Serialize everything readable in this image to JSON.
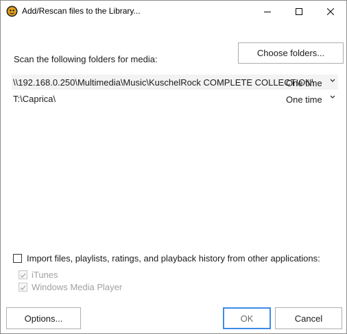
{
  "window": {
    "title": "Add/Rescan files to the Library...",
    "app_icon": "mediamonkey-icon"
  },
  "titlebar_buttons": [
    "minimize-icon",
    "maximize-icon",
    "close-icon"
  ],
  "scan": {
    "label": "Scan the following folders for media:",
    "choose_button": "Choose folders..."
  },
  "folders": [
    {
      "path": "\\\\192.168.0.250\\Multimedia\\Music\\KuschelRock COMPLETE COLLECTION\\",
      "frequency": "One time",
      "selected": true
    },
    {
      "path": "T:\\Caprica\\",
      "frequency": "One time",
      "selected": false
    }
  ],
  "import": {
    "label": "Import files, playlists, ratings, and playback history from other applications:",
    "checked": false,
    "sources": [
      {
        "label": "iTunes",
        "checked": true,
        "disabled": true
      },
      {
        "label": "Windows Media Player",
        "checked": true,
        "disabled": true
      }
    ]
  },
  "buttons": {
    "options": "Options...",
    "ok": "OK",
    "cancel": "Cancel"
  },
  "colors": {
    "ok_border": "#3c8be8",
    "selected_row": "#f3f3f3",
    "disabled_text": "#a0a0a0"
  }
}
